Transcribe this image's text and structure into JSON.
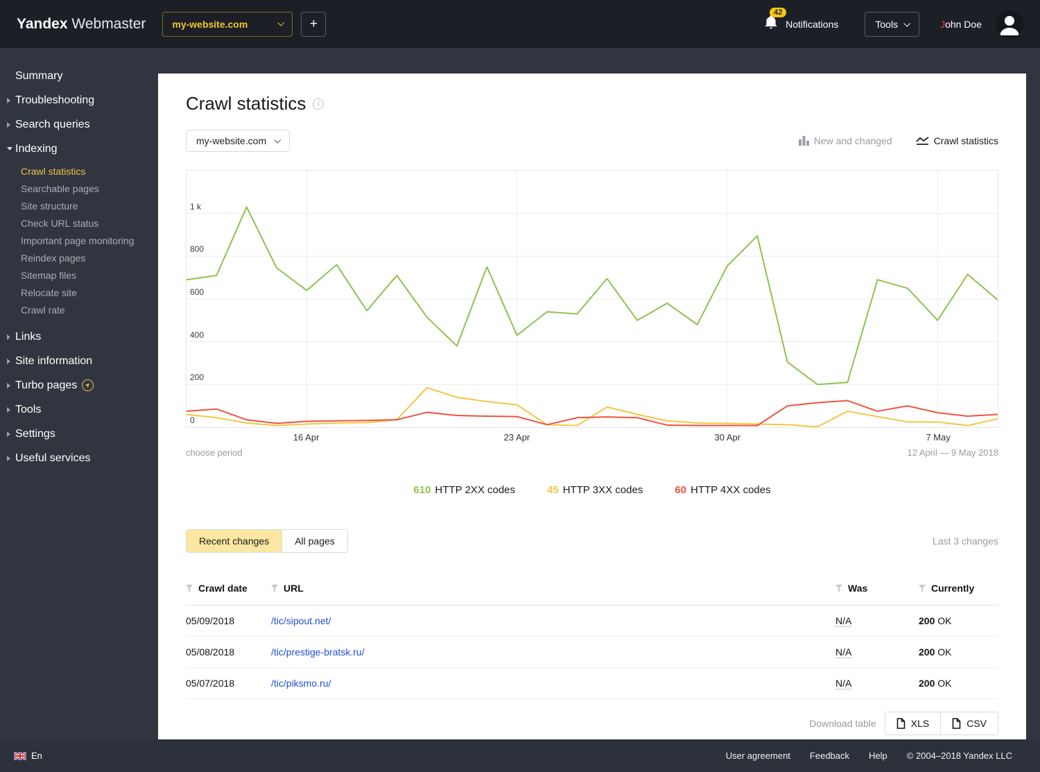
{
  "topbar": {
    "logo_bold": "Yandex",
    "logo_light": "Webmaster",
    "site_selector": "my-website.com",
    "add_button": "+",
    "notifications_count": "42",
    "notifications_label": "Notifications",
    "tools_label": "Tools",
    "user_name": "John Doe"
  },
  "sidebar": {
    "items": [
      {
        "label": "Summary",
        "arrow": "none"
      },
      {
        "label": "Troubleshooting",
        "arrow": "right"
      },
      {
        "label": "Search queries",
        "arrow": "right"
      },
      {
        "label": "Indexing",
        "arrow": "down"
      },
      {
        "label": "Links",
        "arrow": "right"
      },
      {
        "label": "Site information",
        "arrow": "right"
      },
      {
        "label": "Turbo pages",
        "arrow": "right"
      },
      {
        "label": "Tools",
        "arrow": "right"
      },
      {
        "label": "Settings",
        "arrow": "right"
      },
      {
        "label": "Useful services",
        "arrow": "right"
      }
    ],
    "indexing_children": [
      {
        "label": "Crawl statistics",
        "active": true
      },
      {
        "label": "Searchable pages",
        "active": false
      },
      {
        "label": "Site structure",
        "active": false
      },
      {
        "label": "Check URL status",
        "active": false
      },
      {
        "label": "Important page monitoring",
        "active": false
      },
      {
        "label": "Reindex pages",
        "active": false
      },
      {
        "label": "Sitemap files",
        "active": false
      },
      {
        "label": "Relocate site",
        "active": false
      },
      {
        "label": "Crawl rate",
        "active": false
      }
    ],
    "active_color": "#e9c348"
  },
  "content": {
    "title": "Crawl statistics",
    "site_selector": "my-website.com",
    "view_toggles": {
      "new_and_changed": "New and changed",
      "crawl_statistics": "Crawl statistics"
    },
    "choose_period": "choose period",
    "period_range": "12 April — 9 May 2018",
    "legend": [
      {
        "value": "610",
        "label": "HTTP 2XX codes",
        "color": "#8fc150"
      },
      {
        "value": "45",
        "label": "HTTP 3XX codes",
        "color": "#f5c642"
      },
      {
        "value": "60",
        "label": "HTTP 4XX codes",
        "color": "#ef5340"
      }
    ],
    "tabs": {
      "recent": "Recent changes",
      "all": "All pages"
    },
    "last_changes": "Last 3 changes",
    "table": {
      "headers": {
        "date": "Crawl date",
        "url": "URL",
        "was": "Was",
        "currently": "Currently"
      },
      "rows": [
        {
          "date": "05/09/2018",
          "url": "/tic/sipout.net/",
          "was": "N/A",
          "currently_code": "200",
          "currently_text": "OK"
        },
        {
          "date": "05/08/2018",
          "url": "/tic/prestige-bratsk.ru/",
          "was": "N/A",
          "currently_code": "200",
          "currently_text": "OK"
        },
        {
          "date": "05/07/2018",
          "url": "/tic/piksmo.ru/",
          "was": "N/A",
          "currently_code": "200",
          "currently_text": "OK"
        }
      ]
    },
    "download": {
      "label": "Download table",
      "xls": "XLS",
      "csv": "CSV"
    }
  },
  "chart_data": {
    "type": "line",
    "title": "Crawl statistics",
    "period": "12 April — 9 May 2018",
    "days": 28,
    "y_max": 1200,
    "grid": true,
    "y_ticks": [
      {
        "label": "1 k",
        "value": 1000
      },
      {
        "label": "800",
        "value": 800
      },
      {
        "label": "600",
        "value": 600
      },
      {
        "label": "400",
        "value": 400
      },
      {
        "label": "200",
        "value": 200
      },
      {
        "label": "0",
        "value": 0
      }
    ],
    "x_ticks": [
      {
        "label": "16 Apr",
        "day": 4
      },
      {
        "label": "23 Apr",
        "day": 11
      },
      {
        "label": "30 Apr",
        "day": 18
      },
      {
        "label": "7 May",
        "day": 25
      }
    ],
    "series": [
      {
        "name": "HTTP 2XX codes",
        "color": "#8fc150",
        "values": [
          690,
          710,
          1030,
          745,
          640,
          760,
          545,
          710,
          515,
          380,
          750,
          430,
          540,
          530,
          695,
          500,
          580,
          480,
          755,
          895,
          305,
          200,
          210,
          690,
          650,
          500,
          715,
          595
        ]
      },
      {
        "name": "HTTP 3XX codes",
        "color": "#f5c642",
        "values": [
          60,
          45,
          20,
          8,
          15,
          20,
          22,
          35,
          185,
          140,
          120,
          105,
          12,
          8,
          95,
          60,
          30,
          20,
          18,
          15,
          12,
          2,
          75,
          50,
          25,
          25,
          8,
          40
        ]
      },
      {
        "name": "HTTP 4XX codes",
        "color": "#ef5340",
        "values": [
          75,
          85,
          35,
          18,
          28,
          30,
          32,
          35,
          70,
          55,
          52,
          50,
          12,
          45,
          48,
          45,
          10,
          8,
          8,
          8,
          100,
          115,
          125,
          75,
          100,
          68,
          52,
          60
        ]
      }
    ]
  },
  "footer": {
    "lang": "En",
    "links": [
      "User agreement",
      "Feedback",
      "Help"
    ],
    "copyright": "© 2004–2018  Yandex LLC"
  }
}
